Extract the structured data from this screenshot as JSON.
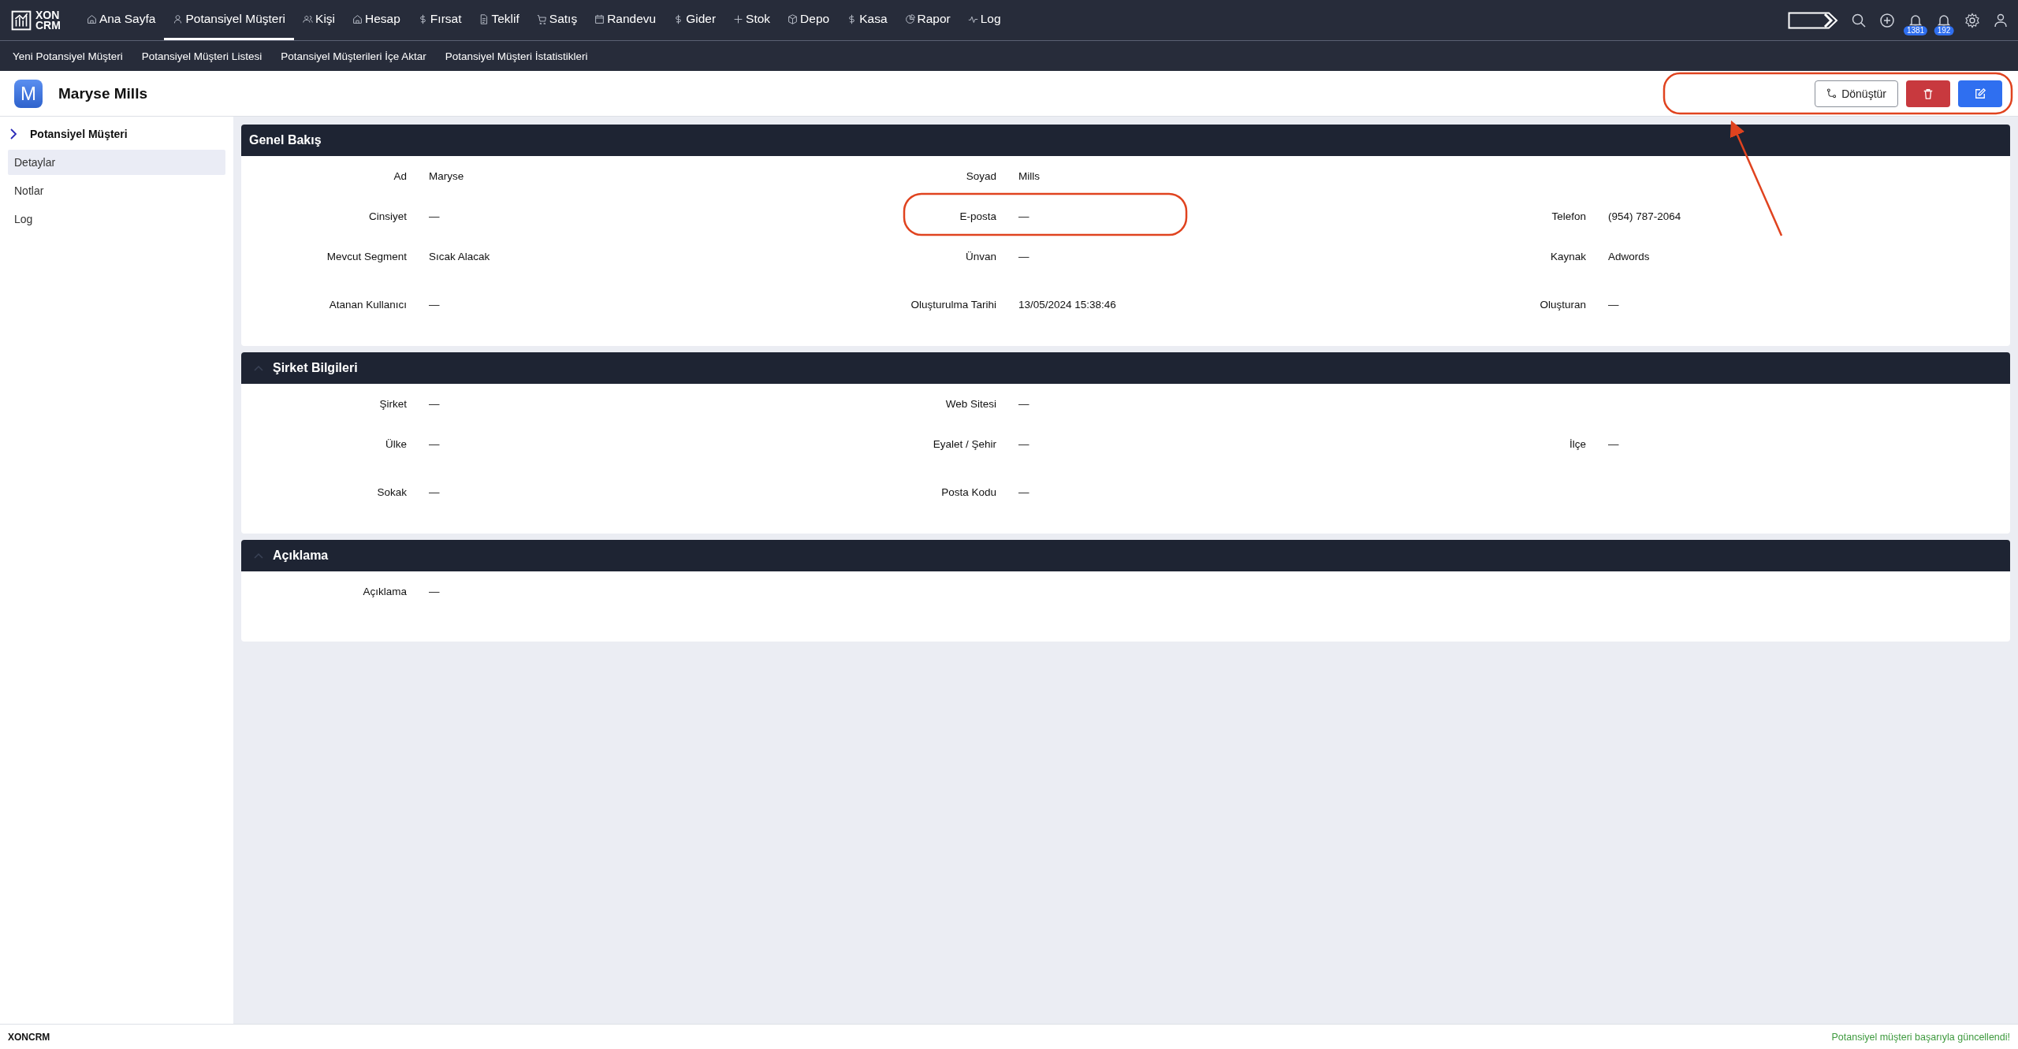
{
  "brand": {
    "line1": "XON",
    "line2": "CRM"
  },
  "nav": [
    {
      "label": "Ana Sayfa",
      "selected": false
    },
    {
      "label": "Potansiyel Müşteri",
      "selected": true
    },
    {
      "label": "Kişi",
      "selected": false
    },
    {
      "label": "Hesap",
      "selected": false
    },
    {
      "label": "Fırsat",
      "selected": false
    },
    {
      "label": "Teklif",
      "selected": false
    },
    {
      "label": "Satış",
      "selected": false
    },
    {
      "label": "Randevu",
      "selected": false
    },
    {
      "label": "Gider",
      "selected": false
    },
    {
      "label": "Stok",
      "selected": false
    },
    {
      "label": "Depo",
      "selected": false
    },
    {
      "label": "Kasa",
      "selected": false
    },
    {
      "label": "Rapor",
      "selected": false
    },
    {
      "label": "Log",
      "selected": false
    }
  ],
  "notifications": [
    "1381",
    "192"
  ],
  "subnav": [
    "Yeni Potansiyel Müşteri",
    "Potansiyel Müşteri Listesi",
    "Potansiyel Müşterileri İçe Aktar",
    "Potansiyel Müşteri İstatistikleri"
  ],
  "record": {
    "avatar_letter": "M",
    "name": "Maryse Mills",
    "convert_button": "Dönüştür"
  },
  "sidebar": {
    "title": "Potansiyel Müşteri",
    "items": [
      {
        "label": "Detaylar",
        "selected": true
      },
      {
        "label": "Notlar",
        "selected": false
      },
      {
        "label": "Log",
        "selected": false
      }
    ]
  },
  "sections": [
    {
      "title": "Genel Bakış",
      "collapsible": false,
      "rows": [
        [
          {
            "label": "Ad",
            "value": "Maryse"
          },
          {
            "label": "Soyad",
            "value": "Mills"
          }
        ],
        [
          {
            "label": "Cinsiyet",
            "value": "—"
          },
          {
            "label": "E-posta",
            "value": "—"
          },
          {
            "label": "Telefon",
            "value": "(954) 787-2064"
          }
        ],
        [
          {
            "label": "Mevcut Segment",
            "value": "Sıcak Alacak"
          },
          {
            "label": "Ünvan",
            "value": "—"
          },
          {
            "label": "Kaynak",
            "value": "Adwords"
          }
        ],
        [
          {
            "label": "Atanan Kullanıcı",
            "value": "—"
          },
          {
            "label": "Oluşturulma Tarihi",
            "value": "13/05/2024 15:38:46"
          },
          {
            "label": "Oluşturan",
            "value": "—"
          }
        ]
      ]
    },
    {
      "title": "Şirket Bilgileri",
      "collapsible": true,
      "rows": [
        [
          {
            "label": "Şirket",
            "value": "—"
          },
          {
            "label": "Web Sitesi",
            "value": "—"
          }
        ],
        [
          {
            "label": "Ülke",
            "value": "—"
          },
          {
            "label": "Eyalet / Şehir",
            "value": "—"
          },
          {
            "label": "İlçe",
            "value": "—"
          }
        ],
        [
          {
            "label": "Sokak",
            "value": "—"
          },
          {
            "label": "Posta Kodu",
            "value": "—"
          }
        ]
      ]
    },
    {
      "title": "Açıklama",
      "collapsible": true,
      "rows": [
        [
          {
            "label": "Açıklama",
            "value": "—"
          }
        ]
      ]
    }
  ],
  "footer": {
    "brand": "XONCRM",
    "message": "Potansiyel müşteri başarıyla güncellendi!"
  }
}
